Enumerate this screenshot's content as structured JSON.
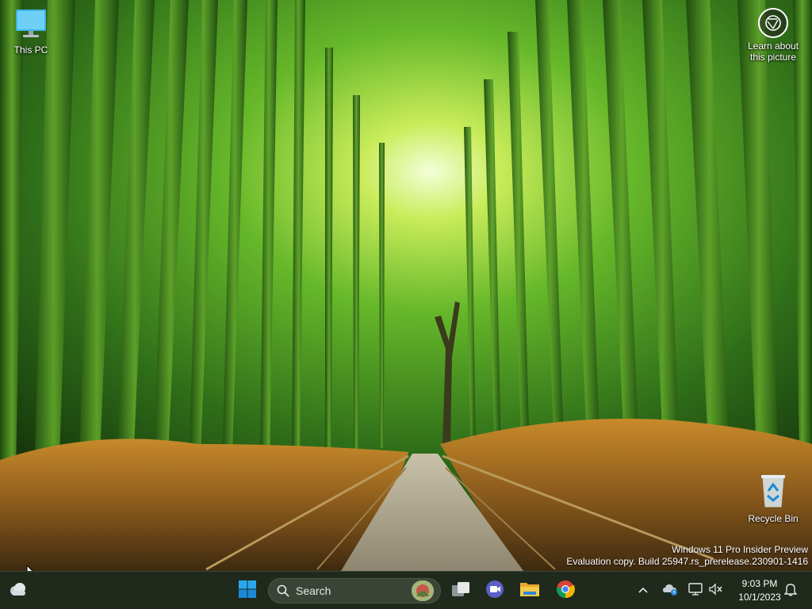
{
  "desktop": {
    "icons": [
      {
        "label": "This PC",
        "icon": "monitor-icon"
      },
      {
        "label": "Recycle Bin",
        "icon": "recycle-bin-icon"
      }
    ],
    "spotlight": {
      "label_line1": "Learn about",
      "label_line2": "this picture",
      "icon": "camera-aperture-icon"
    },
    "watermark": {
      "line1": "Windows 11 Pro Insider Preview",
      "line2": "Evaluation copy. Build 25947.rs_prerelease.230901-1416"
    }
  },
  "taskbar": {
    "search_label": "Search",
    "apps": [
      {
        "name": "Task View",
        "icon": "task-view-icon"
      },
      {
        "name": "Meet",
        "icon": "video-camera-icon"
      },
      {
        "name": "File Explorer",
        "icon": "folder-icon"
      },
      {
        "name": "Google Chrome",
        "icon": "chrome-icon"
      }
    ],
    "tray": {
      "time": "9:03 PM",
      "date": "10/1/2023"
    }
  },
  "colors": {
    "taskbar_bg": "#1f2a1c",
    "accent": "#1a8ad8"
  }
}
